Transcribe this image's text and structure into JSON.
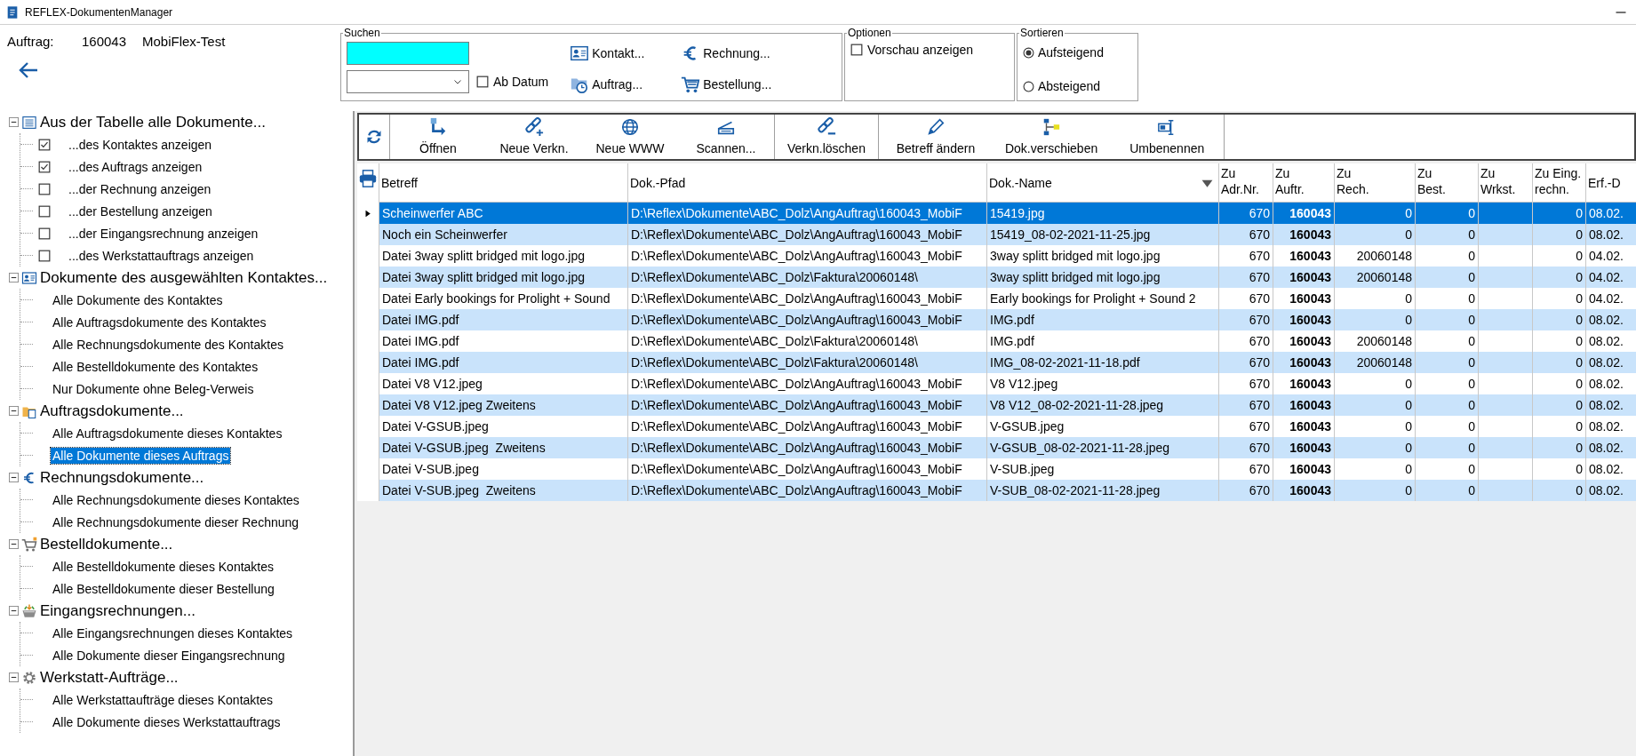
{
  "window": {
    "title": "REFLEX-DokumentenManager"
  },
  "order": {
    "label": "Auftrag:",
    "number": "160043",
    "name": "MobiFlex-Test"
  },
  "search": {
    "title": "Suchen",
    "since_date": {
      "label": "Ab Datum",
      "checked": false
    },
    "buttons": [
      "Kontakt...",
      "Rechnung...",
      "Auftrag...",
      "Bestellung..."
    ]
  },
  "options": {
    "title": "Optionen",
    "items": [
      {
        "label": "Vorschau anzeigen",
        "checked": false
      }
    ]
  },
  "sort": {
    "title": "Sortieren",
    "items": [
      {
        "label": "Aufsteigend",
        "selected": true
      },
      {
        "label": "Absteigend",
        "selected": false
      }
    ]
  },
  "tree": [
    {
      "label": "Aus der Tabelle alle Dokumente...",
      "expanded": true,
      "children": [
        {
          "kind": "checkbox",
          "label": "...des Kontaktes anzeigen",
          "checked": true,
          "selected": false
        },
        {
          "kind": "checkbox",
          "label": "...des Auftrags anzeigen",
          "checked": true,
          "selected": false
        },
        {
          "kind": "checkbox",
          "label": "...der Rechnung anzeigen",
          "checked": false,
          "selected": false
        },
        {
          "kind": "checkbox",
          "label": "...der Bestellung anzeigen",
          "checked": false,
          "selected": false
        },
        {
          "kind": "checkbox",
          "label": "...der Eingangsrechnung anzeigen",
          "checked": false,
          "selected": false
        },
        {
          "kind": "checkbox",
          "label": "...des Werkstattauftrags anzeigen",
          "checked": false,
          "selected": false
        }
      ]
    },
    {
      "label": "Dokumente des ausgewählten Kontaktes...",
      "expanded": true,
      "children": [
        {
          "kind": "link",
          "label": "Alle Dokumente des Kontaktes",
          "selected": false
        },
        {
          "kind": "link",
          "label": "Alle Auftragsdokumente des Kontaktes",
          "selected": false
        },
        {
          "kind": "link",
          "label": "Alle Rechnungsdokumente des Kontaktes",
          "selected": false
        },
        {
          "kind": "link",
          "label": "Alle Bestelldokumente des Kontaktes",
          "selected": false
        },
        {
          "kind": "link",
          "label": "Nur Dokumente ohne Beleg-Verweis",
          "selected": false
        }
      ]
    },
    {
      "label": "Auftragsdokumente...",
      "expanded": true,
      "children": [
        {
          "kind": "link",
          "label": "Alle Auftragsdokumente dieses Kontaktes",
          "selected": false
        },
        {
          "kind": "link",
          "label": "Alle Dokumente dieses Auftrags",
          "selected": true
        }
      ]
    },
    {
      "label": "Rechnungsdokumente...",
      "expanded": true,
      "children": [
        {
          "kind": "link",
          "label": "Alle Rechnungsdokumente dieses Kontaktes",
          "selected": false
        },
        {
          "kind": "link",
          "label": "Alle Rechnungsdokumente dieser Rechnung",
          "selected": false
        }
      ]
    },
    {
      "label": "Bestelldokumente...",
      "expanded": true,
      "children": [
        {
          "kind": "link",
          "label": "Alle Bestelldokumente dieses Kontaktes",
          "selected": false
        },
        {
          "kind": "link",
          "label": "Alle Bestelldokumente dieser Bestellung",
          "selected": false
        }
      ]
    },
    {
      "label": "Eingangsrechnungen...",
      "expanded": true,
      "children": [
        {
          "kind": "link",
          "label": "Alle Eingangsrechnungen dieses Kontaktes",
          "selected": false
        },
        {
          "kind": "link",
          "label": "Alle Dokumente dieser Eingangsrechnung",
          "selected": false
        }
      ]
    },
    {
      "label": "Werkstatt-Aufträge...",
      "expanded": true,
      "children": [
        {
          "kind": "link",
          "label": "Alle Werkstattaufträge dieses Kontaktes",
          "selected": false
        },
        {
          "kind": "link",
          "label": "Alle Dokumente dieses Werkstattauftrags",
          "selected": false
        }
      ]
    }
  ],
  "toolbar": {
    "groups": [
      [
        "Öffnen",
        "Neue Verkn.",
        "Neue WWW",
        "Scannen..."
      ],
      [
        "Verkn.löschen"
      ],
      [
        "Betreff ändern",
        "Dok.verschieben",
        "Umbenennen"
      ]
    ]
  },
  "table": {
    "columns": [
      {
        "label": "Betreff",
        "kind": "text",
        "sorted": false
      },
      {
        "label": "Dok.-Pfad",
        "kind": "text",
        "sorted": false
      },
      {
        "label": "Dok.-Name",
        "kind": "text",
        "sorted": true
      },
      {
        "label": "Zu\nAdr.Nr.",
        "kind": "number",
        "sorted": false
      },
      {
        "label": "Zu\nAuftr.",
        "kind": "number",
        "sorted": false,
        "bold": true
      },
      {
        "label": "Zu\nRech.",
        "kind": "number",
        "sorted": false
      },
      {
        "label": "Zu\nBest.",
        "kind": "number",
        "sorted": false
      },
      {
        "label": "Zu\nWrkst.",
        "kind": "number",
        "sorted": false
      },
      {
        "label": "Zu Eing.\nrechn.",
        "kind": "number",
        "sorted": false
      },
      {
        "label": "Erf.-D",
        "kind": "text",
        "sorted": false
      }
    ],
    "rows": [
      {
        "selected": true,
        "current": true,
        "cells": [
          "Scheinwerfer ABC",
          "D:\\Reflex\\Dokumente\\ABC_Dolz\\AngAuftrag\\160043_MobiF",
          "15419.jpg",
          "670",
          "160043",
          "0",
          "0",
          null,
          "0",
          "08.02."
        ]
      },
      {
        "selected": false,
        "current": false,
        "cells": [
          "Noch ein Scheinwerfer",
          "D:\\Reflex\\Dokumente\\ABC_Dolz\\AngAuftrag\\160043_MobiF",
          "15419_08-02-2021-11-25.jpg",
          "670",
          "160043",
          "0",
          "0",
          null,
          "0",
          "08.02."
        ]
      },
      {
        "selected": false,
        "current": false,
        "cells": [
          "Datei 3way splitt bridged mit logo.jpg",
          "D:\\Reflex\\Dokumente\\ABC_Dolz\\AngAuftrag\\160043_MobiF",
          "3way splitt bridged mit logo.jpg",
          "670",
          "160043",
          "20060148",
          "0",
          null,
          "0",
          "04.02."
        ]
      },
      {
        "selected": false,
        "current": false,
        "cells": [
          "Datei 3way splitt bridged mit logo.jpg",
          "D:\\Reflex\\Dokumente\\ABC_Dolz\\Faktura\\20060148\\",
          "3way splitt bridged mit logo.jpg",
          "670",
          "160043",
          "20060148",
          "0",
          null,
          "0",
          "04.02."
        ]
      },
      {
        "selected": false,
        "current": false,
        "cells": [
          "Datei Early bookings for Prolight + Sound",
          "D:\\Reflex\\Dokumente\\ABC_Dolz\\AngAuftrag\\160043_MobiF",
          "Early bookings for Prolight + Sound 2",
          "670",
          "160043",
          "0",
          "0",
          null,
          "0",
          "04.02."
        ]
      },
      {
        "selected": false,
        "current": false,
        "cells": [
          "Datei IMG.pdf",
          "D:\\Reflex\\Dokumente\\ABC_Dolz\\AngAuftrag\\160043_MobiF",
          "IMG.pdf",
          "670",
          "160043",
          "0",
          "0",
          null,
          "0",
          "08.02."
        ]
      },
      {
        "selected": false,
        "current": false,
        "cells": [
          "Datei IMG.pdf",
          "D:\\Reflex\\Dokumente\\ABC_Dolz\\Faktura\\20060148\\",
          "IMG.pdf",
          "670",
          "160043",
          "20060148",
          "0",
          null,
          "0",
          "08.02."
        ]
      },
      {
        "selected": false,
        "current": false,
        "cells": [
          "Datei IMG.pdf",
          "D:\\Reflex\\Dokumente\\ABC_Dolz\\Faktura\\20060148\\",
          "IMG_08-02-2021-11-18.pdf",
          "670",
          "160043",
          "20060148",
          "0",
          null,
          "0",
          "08.02."
        ]
      },
      {
        "selected": false,
        "current": false,
        "cells": [
          "Datei V8 V12.jpeg",
          "D:\\Reflex\\Dokumente\\ABC_Dolz\\AngAuftrag\\160043_MobiF",
          "V8 V12.jpeg",
          "670",
          "160043",
          "0",
          "0",
          null,
          "0",
          "08.02."
        ]
      },
      {
        "selected": false,
        "current": false,
        "cells": [
          "Datei V8 V12.jpeg Zweitens",
          "D:\\Reflex\\Dokumente\\ABC_Dolz\\AngAuftrag\\160043_MobiF",
          "V8 V12_08-02-2021-11-28.jpeg",
          "670",
          "160043",
          "0",
          "0",
          null,
          "0",
          "08.02."
        ]
      },
      {
        "selected": false,
        "current": false,
        "cells": [
          "Datei V-GSUB.jpeg",
          "D:\\Reflex\\Dokumente\\ABC_Dolz\\AngAuftrag\\160043_MobiF",
          "V-GSUB.jpeg",
          "670",
          "160043",
          "0",
          "0",
          null,
          "0",
          "08.02."
        ]
      },
      {
        "selected": false,
        "current": false,
        "cells": [
          "Datei V-GSUB.jpeg  Zweitens",
          "D:\\Reflex\\Dokumente\\ABC_Dolz\\AngAuftrag\\160043_MobiF",
          "V-GSUB_08-02-2021-11-28.jpeg",
          "670",
          "160043",
          "0",
          "0",
          null,
          "0",
          "08.02."
        ]
      },
      {
        "selected": false,
        "current": false,
        "cells": [
          "Datei V-SUB.jpeg",
          "D:\\Reflex\\Dokumente\\ABC_Dolz\\AngAuftrag\\160043_MobiF",
          "V-SUB.jpeg",
          "670",
          "160043",
          "0",
          "0",
          null,
          "0",
          "08.02."
        ]
      },
      {
        "selected": false,
        "current": false,
        "cells": [
          "Datei V-SUB.jpeg  Zweitens",
          "D:\\Reflex\\Dokumente\\ABC_Dolz\\AngAuftrag\\160043_MobiF",
          "V-SUB_08-02-2021-11-28.jpeg",
          "670",
          "160043",
          "0",
          "0",
          null,
          "0",
          "08.02."
        ]
      }
    ]
  }
}
